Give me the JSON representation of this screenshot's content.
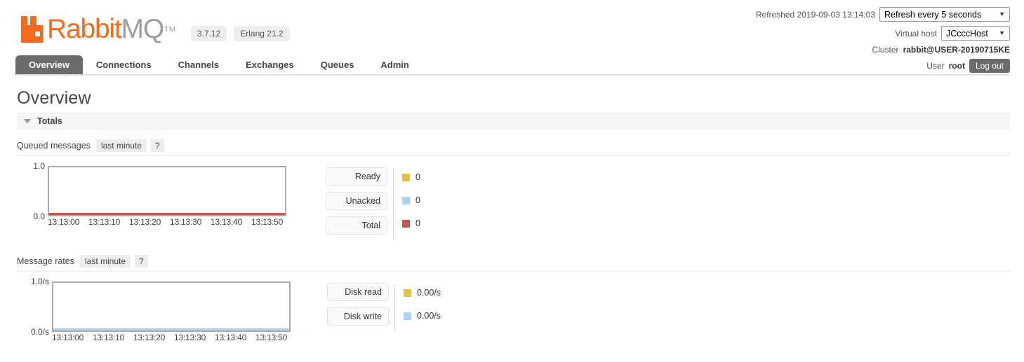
{
  "header": {
    "brand_rabbit": "Rabbit",
    "brand_mq": "MQ",
    "brand_tm": "TM",
    "logo_icon": "rabbitmq-logo-icon",
    "version_badge": "3.7.12",
    "erlang_badge": "Erlang 21.2",
    "brand_orange": "#f26b21",
    "brand_grey": "#9aa0a0"
  },
  "status": {
    "refreshed_label": "Refreshed 2019-09-03 13:14:03",
    "refresh_select": "Refresh every 5 seconds",
    "vhost_label": "Virtual host",
    "vhost_select": "JCcccHost",
    "cluster_label": "Cluster",
    "cluster_value": "rabbit@USER-20190715KE",
    "user_label": "User",
    "user_value": "root",
    "logout_label": "Log out",
    "caret_icon": "chevron-down-icon"
  },
  "nav": {
    "tabs": [
      {
        "label": "Overview",
        "active": true
      },
      {
        "label": "Connections",
        "active": false
      },
      {
        "label": "Channels",
        "active": false
      },
      {
        "label": "Exchanges",
        "active": false
      },
      {
        "label": "Queues",
        "active": false
      },
      {
        "label": "Admin",
        "active": false
      }
    ]
  },
  "page": {
    "title": "Overview",
    "totals_label": "Totals",
    "totals_toggle_icon": "triangle-down-icon"
  },
  "charts": [
    {
      "title": "Queued messages",
      "period_chip": "last minute",
      "help_chip": "?",
      "y_top": "1.0",
      "y_bottom": "0.0",
      "x_ticks": [
        "13:13:00",
        "13:13:10",
        "13:13:20",
        "13:13:30",
        "13:13:40",
        "13:13:50"
      ],
      "baseline_color": "#c9534c",
      "legend": [
        {
          "label": "Ready",
          "value": "0",
          "color": "#e5c13c"
        },
        {
          "label": "Unacked",
          "value": "0",
          "color": "#aad4f5"
        },
        {
          "label": "Total",
          "value": "0",
          "color": "#c9534c"
        }
      ]
    },
    {
      "title": "Message rates",
      "period_chip": "last minute",
      "help_chip": "?",
      "y_top": "1.0/s",
      "y_bottom": "0.0/s",
      "x_ticks": [
        "13:13:00",
        "13:13:10",
        "13:13:20",
        "13:13:30",
        "13:13:40",
        "13:13:50"
      ],
      "baseline_color": "#aad4f5",
      "legend": [
        {
          "label": "Disk read",
          "value": "0.00/s",
          "color": "#e5c13c"
        },
        {
          "label": "Disk write",
          "value": "0.00/s",
          "color": "#aad4f5"
        }
      ]
    }
  ],
  "chart_data": [
    {
      "type": "line",
      "title": "Queued messages",
      "subtitle": "last minute",
      "xlabel": "",
      "ylabel": "",
      "ylim": [
        0,
        1
      ],
      "yticks": [
        "0.0",
        "1.0"
      ],
      "x": [
        "13:13:00",
        "13:13:10",
        "13:13:20",
        "13:13:30",
        "13:13:40",
        "13:13:50"
      ],
      "grid": false,
      "legend_position": "right",
      "series": [
        {
          "name": "Ready",
          "values": [
            0,
            0,
            0,
            0,
            0,
            0
          ],
          "color": "#e5c13c",
          "current": 0
        },
        {
          "name": "Unacked",
          "values": [
            0,
            0,
            0,
            0,
            0,
            0
          ],
          "color": "#aad4f5",
          "current": 0
        },
        {
          "name": "Total",
          "values": [
            0,
            0,
            0,
            0,
            0,
            0
          ],
          "color": "#c9534c",
          "current": 0
        }
      ]
    },
    {
      "type": "line",
      "title": "Message rates",
      "subtitle": "last minute",
      "xlabel": "",
      "ylabel": "",
      "ylim": [
        0,
        1
      ],
      "yticks": [
        "0.0/s",
        "1.0/s"
      ],
      "x": [
        "13:13:00",
        "13:13:10",
        "13:13:20",
        "13:13:30",
        "13:13:40",
        "13:13:50"
      ],
      "grid": false,
      "legend_position": "right",
      "series": [
        {
          "name": "Disk read",
          "values": [
            0,
            0,
            0,
            0,
            0,
            0
          ],
          "color": "#e5c13c",
          "current": "0.00/s"
        },
        {
          "name": "Disk write",
          "values": [
            0,
            0,
            0,
            0,
            0,
            0
          ],
          "color": "#aad4f5",
          "current": "0.00/s"
        }
      ]
    }
  ]
}
